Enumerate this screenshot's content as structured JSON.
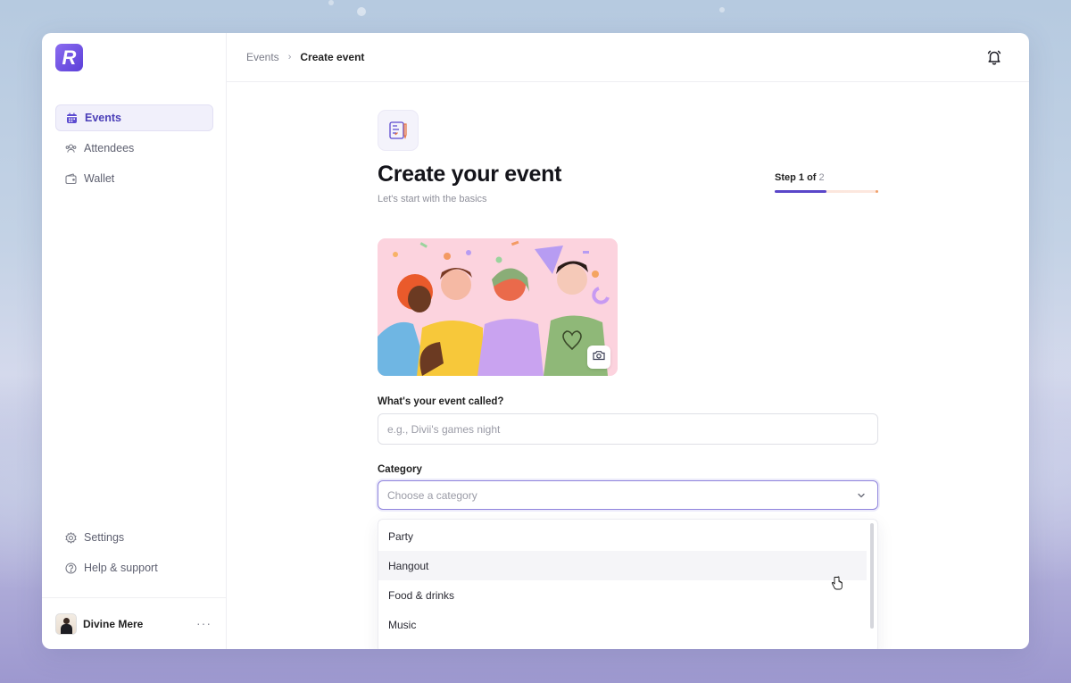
{
  "app": {
    "logo_letter": "R",
    "brand_color": "#5b3fd8"
  },
  "sidebar": {
    "items": [
      {
        "label": "Events",
        "icon": "calendar-icon",
        "active": true
      },
      {
        "label": "Attendees",
        "icon": "users-icon",
        "active": false
      },
      {
        "label": "Wallet",
        "icon": "wallet-icon",
        "active": false
      }
    ],
    "bottom_items": [
      {
        "label": "Settings",
        "icon": "gear-icon"
      },
      {
        "label": "Help & support",
        "icon": "help-icon"
      }
    ],
    "user": {
      "name": "Divine Mere",
      "more": "···"
    }
  },
  "breadcrumb": {
    "parent": "Events",
    "separator": "›",
    "current": "Create event"
  },
  "header": {
    "notification_icon": "bell-icon"
  },
  "form": {
    "title": "Create your event",
    "subtitle": "Let's start with the basics",
    "step": {
      "prefix": "Step 1 of ",
      "total": "2",
      "current": 1,
      "count": 2
    },
    "cover_image": {
      "icon": "camera-icon"
    },
    "name_field": {
      "label": "What's your event called?",
      "placeholder": "e.g., Divii's games night",
      "value": ""
    },
    "category_field": {
      "label": "Category",
      "placeholder": "Choose a category",
      "options": [
        "Party",
        "Hangout",
        "Food & drinks",
        "Music"
      ],
      "hovered_option": "Hangout"
    }
  }
}
